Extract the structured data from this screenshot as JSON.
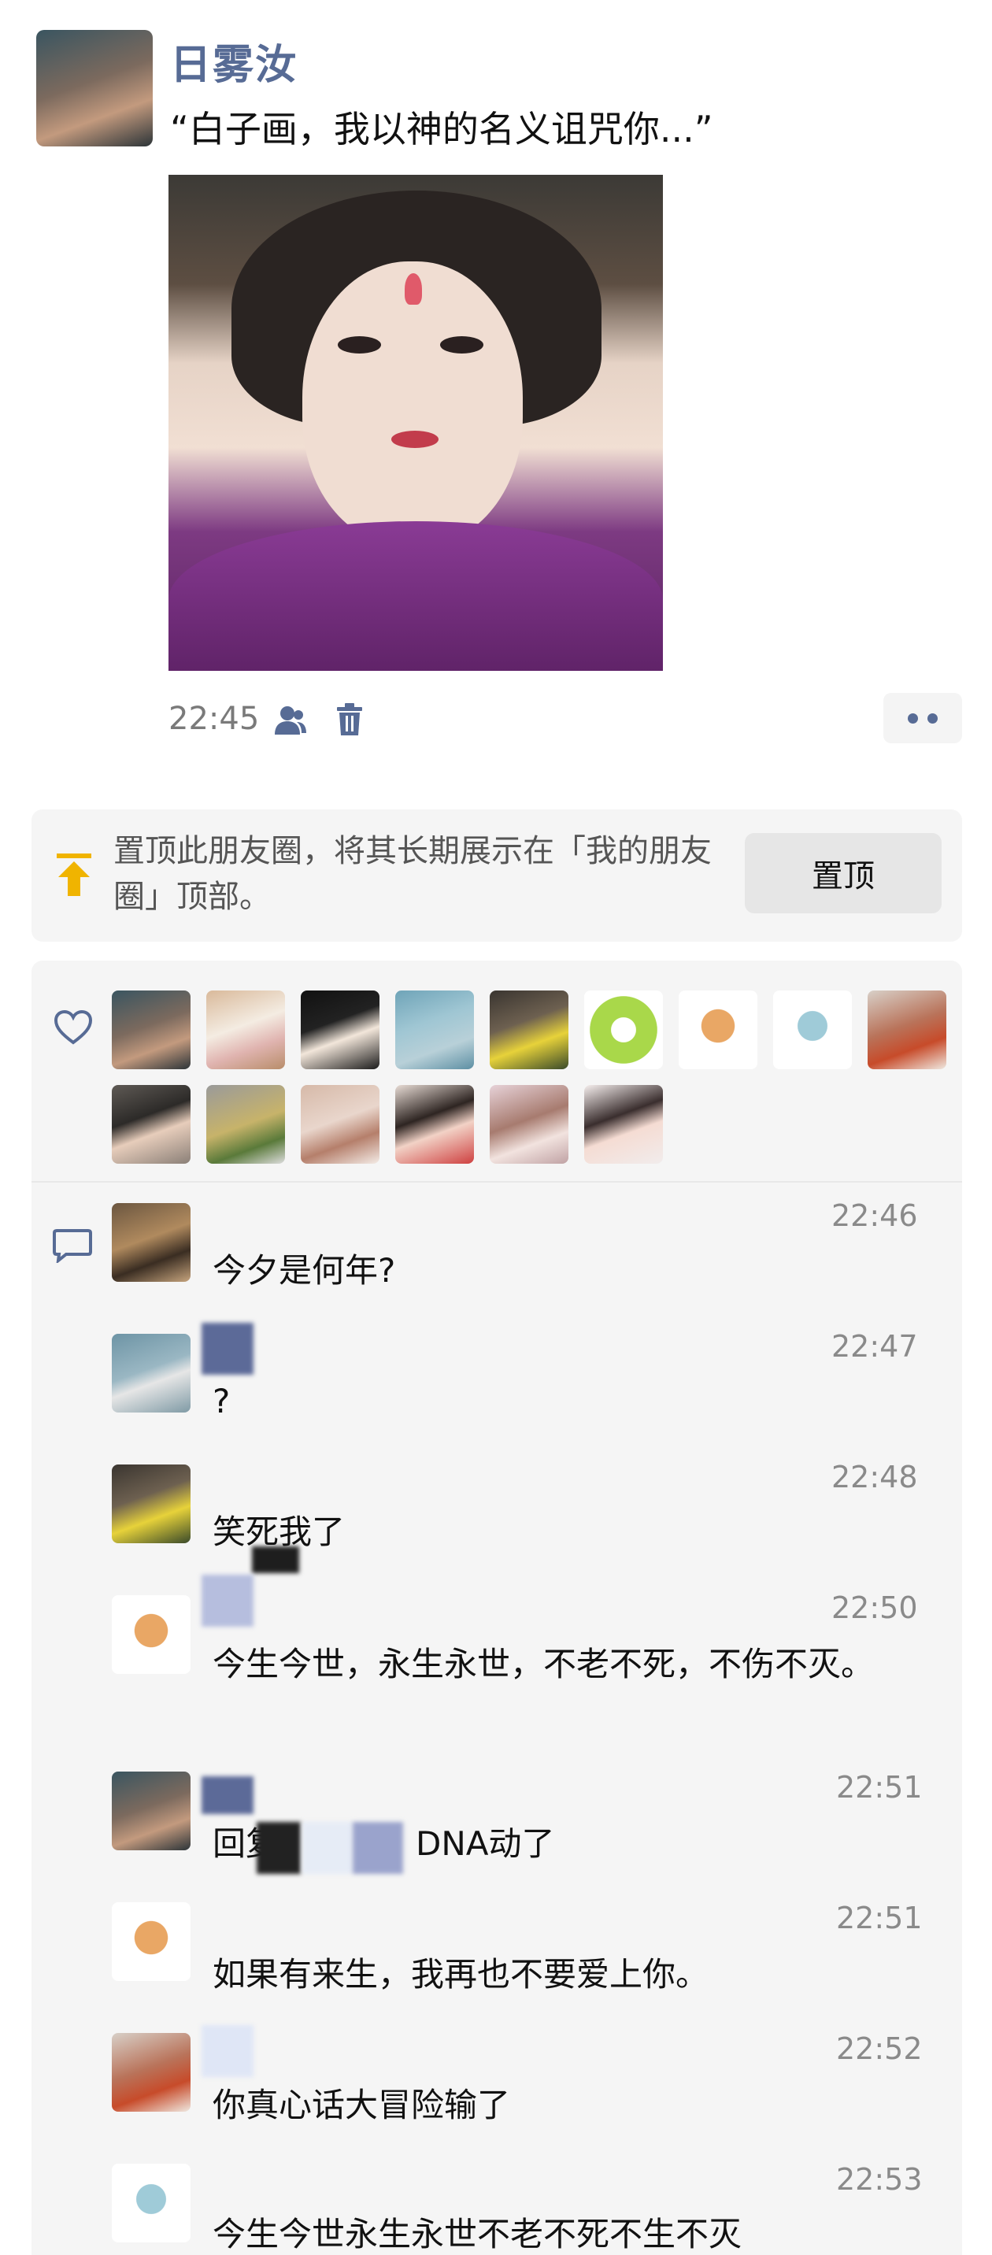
{
  "post": {
    "author": "日雾汝",
    "text": "“白子画，我以神的名义诅咒你...”",
    "time": "22:45"
  },
  "pin": {
    "text": "置顶此朋友圈，将其长期展示在「我的朋友圈」顶部。",
    "button": "置顶"
  },
  "likes": {
    "avatars": [
      "face",
      "cake",
      "anime",
      "sea",
      "yellow",
      "flower",
      "cat",
      "bluecat",
      "girl1",
      "girl2",
      "plant",
      "girl3",
      "girl4",
      "girl5",
      "girl6"
    ]
  },
  "comments": [
    {
      "time": "22:46",
      "text": "今夕是何年?"
    },
    {
      "time": "22:47",
      "text": "?"
    },
    {
      "time": "22:48",
      "text": "笑死我了"
    },
    {
      "time": "22:50",
      "text": "今生今世，永生永世，不老不死，不伤不灭。"
    },
    {
      "time": "22:51",
      "text_prefix": "回复",
      "text_suffix": "DNA动了"
    },
    {
      "time": "22:51",
      "text": "如果有来生，我再也不要爱上你。"
    },
    {
      "time": "22:52",
      "text": "你真心话大冒险输了"
    },
    {
      "time": "22:53",
      "text": "今生今世永生永世不老不死不生不灭"
    }
  ],
  "icons": {
    "visibility": "person-icon",
    "delete": "trash-icon",
    "more": "more-dots-icon",
    "pin": "pin-top-icon",
    "like": "heart-icon",
    "comment": "comment-icon"
  },
  "colors": {
    "link": "#576b95",
    "pin_arrow": "#f0b400",
    "panel_bg": "#f5f5f5"
  }
}
